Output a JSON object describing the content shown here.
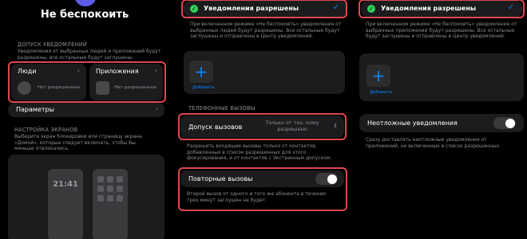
{
  "screen1": {
    "title": "Не беспокоить",
    "allowed_section": "ДОПУСК УВЕДОМЛЕНИЙ",
    "allowed_desc": "Уведомления от выбранных людей и приложений будут разрешены, все остальные будут заглушены.",
    "people_label": "Люди",
    "people_status": "Нет разрешенных",
    "apps_label": "Приложения",
    "apps_status": "Нет разрешенных",
    "options_label": "Параметры",
    "screens_section": "НАСТРОЙКА ЭКРАНОВ",
    "screens_desc": "Выберите экран блокировки или страницу экрана «Домой», которые следует включать, чтобы Вы меньше отвлекались.",
    "lock_time": "21:41"
  },
  "screen2": {
    "notif_allowed": "Уведомления разрешены",
    "notif_desc": "При включенном режиме «Не беспокоить» уведомления от выбранных людей будут разрешены. Все остальные будут заглушены и отправлены в Центр уведомлений.",
    "add_label": "Добавить",
    "phone_section": "ТЕЛЕФОННЫЕ ВЫЗОВЫ",
    "calls_label": "Допуск вызовов",
    "calls_value": "Только от тех, кому разрешено",
    "calls_desc": "Разрешить входящие вызовы только от контактов, добавленных в список разрешенных для этого фокусирования, и от контактов с Экстренным допуском.",
    "repeat_label": "Повторные вызовы",
    "repeat_desc": "Второй вызов от одного и того же абонента в течение трех минут заглушен не будет."
  },
  "screen3": {
    "notif_allowed": "Уведомления разрешены",
    "notif_desc": "При включенном режиме «Не беспокоить» уведомления от выбранных приложений будут разрешены. Все остальные будут заглушены и отправлены в Центр уведомлений.",
    "add_label": "Добавить",
    "urgent_label": "Неотложные уведомления",
    "urgent_desc": "Сразу доставлять неотложные уведомления от приложений, не включенных в список разрешенных."
  },
  "colors": {
    "accent": "#0a84ff",
    "highlight": "#e0474e",
    "check_green": "#30d158",
    "focus_purple": "#5e5ce6"
  }
}
